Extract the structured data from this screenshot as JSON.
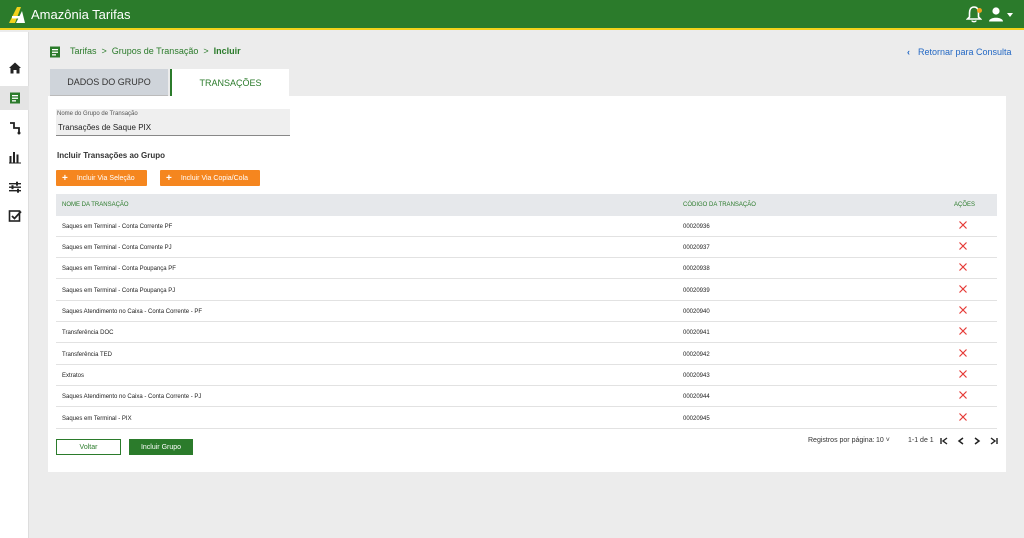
{
  "header": {
    "app_title": "Amazônia Tarifas"
  },
  "sidebar": {
    "items": [
      {
        "icon": "home-icon",
        "active": false
      },
      {
        "icon": "receipt-icon",
        "active": true
      },
      {
        "icon": "route-icon",
        "active": false
      },
      {
        "icon": "bar-chart-icon",
        "active": false
      },
      {
        "icon": "sliders-icon",
        "active": false
      },
      {
        "icon": "checkbox-icon",
        "active": false
      }
    ]
  },
  "breadcrumb": {
    "root": "Tarifas",
    "sep": ">",
    "middle": "Grupos de Transação",
    "current": "Incluir"
  },
  "back_link": {
    "label": "Retornar para Consulta"
  },
  "tabs": [
    {
      "label": "DADOS DO GRUPO",
      "active": false
    },
    {
      "label": "TRANSAÇÕES",
      "active": true
    }
  ],
  "form": {
    "group_name_label": "Nome do Grupo de Transação",
    "group_name_value": "Transações de Saque PIX"
  },
  "section_title": "Incluir Transações ao Grupo",
  "actions": {
    "add_selection": "Incluir Via Seleção",
    "add_copy_paste": "Incluir Via Copia/Cola"
  },
  "table": {
    "columns": [
      "NOME DA TRANSAÇÃO",
      "CÓDIGO DA TRANSAÇÃO",
      "AÇÕES"
    ],
    "rows": [
      {
        "name": "Saques em Terminal - Conta Corrente PF",
        "code": "00020936"
      },
      {
        "name": "Saques em Terminal - Conta Corrente PJ",
        "code": "00020937"
      },
      {
        "name": "Saques em Terminal - Conta Poupança PF",
        "code": "00020938"
      },
      {
        "name": "Saques em Terminal - Conta Poupança PJ",
        "code": "00020939"
      },
      {
        "name": "Saques Atendimento no Caixa - Conta Corrente - PF",
        "code": "00020940"
      },
      {
        "name": "Transferência DOC",
        "code": "00020941"
      },
      {
        "name": "Transferência TED",
        "code": "00020942"
      },
      {
        "name": "Extratos",
        "code": "00020943"
      },
      {
        "name": "Saques Atendimento no Caixa - Conta Corrente - PJ",
        "code": "00020944"
      },
      {
        "name": "Saques em Terminal - PIX",
        "code": "00020945"
      }
    ]
  },
  "footer": {
    "back_label": "Voltar",
    "submit_label": "Incluir Grupo",
    "rows_per_page_label": "Registros por página:",
    "rows_per_page_value": "10",
    "range": "1-1 de 1"
  },
  "colors": {
    "primary_green": "#2b7b2b",
    "accent_yellow": "#f2d21b",
    "orange": "#f5861f",
    "link_blue": "#2368c4",
    "delete_red": "#e53935"
  }
}
